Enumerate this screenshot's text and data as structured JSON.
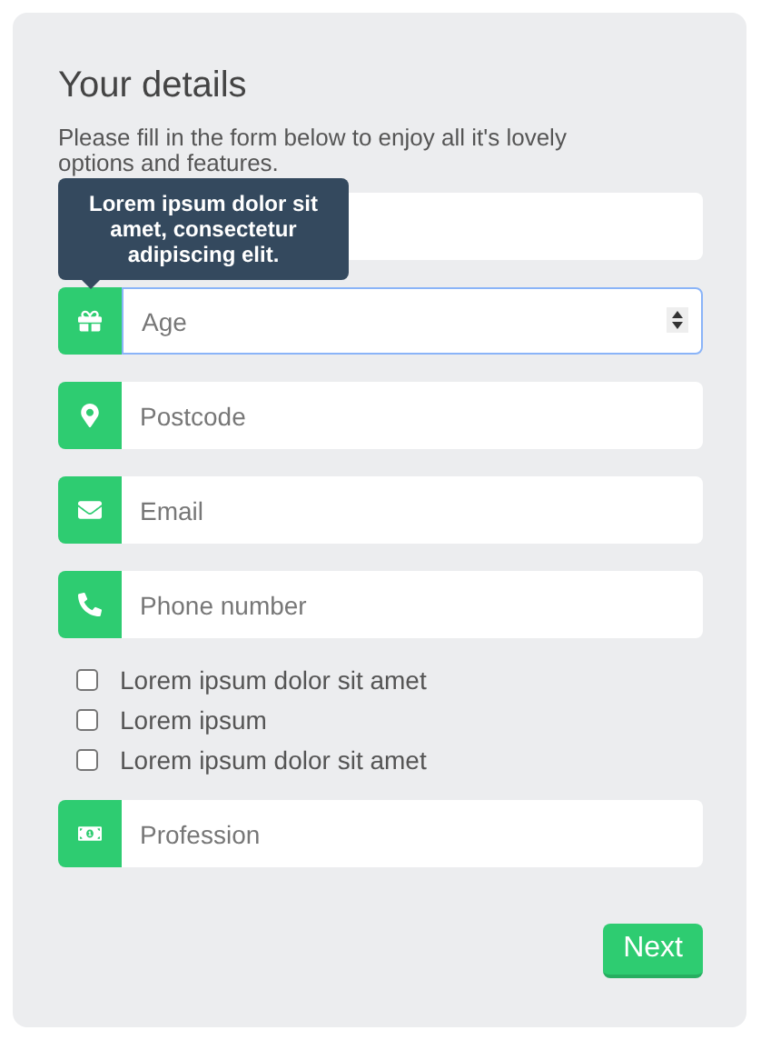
{
  "title": "Your details",
  "description": "Please fill in the form below to enjoy all it's lovely options and features.",
  "tooltip": "Lorem ipsum dolor sit amet, consectetur adipiscing elit.",
  "items": [
    {
      "kind": "covered",
      "focused": false
    },
    {
      "kind": "number",
      "placeholder": "Age",
      "focused": true
    },
    {
      "kind": "text",
      "placeholder": "Postcode",
      "focused": false
    },
    {
      "kind": "text",
      "placeholder": "Email",
      "focused": false
    },
    {
      "kind": "text",
      "placeholder": "Phone number",
      "focused": false
    },
    {
      "kind": "checkbox",
      "label": "Lorem ipsum dolor sit amet",
      "checked": false
    },
    {
      "kind": "checkbox",
      "label": "Lorem ipsum",
      "checked": false
    },
    {
      "kind": "checkbox",
      "label": "Lorem ipsum dolor sit amet",
      "checked": false
    },
    {
      "kind": "text",
      "placeholder": "Profession",
      "focused": false
    }
  ],
  "next_button": "Next"
}
